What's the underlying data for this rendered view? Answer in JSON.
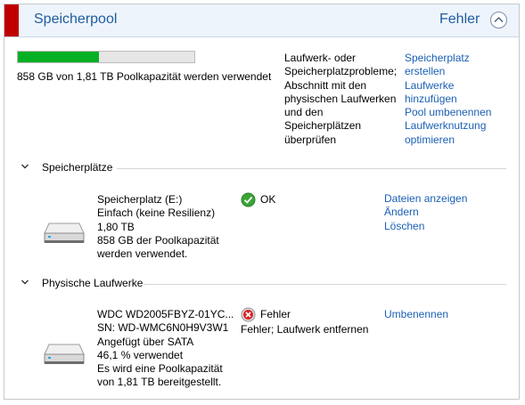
{
  "header": {
    "title": "Speicherpool",
    "status": "Fehler",
    "flag_color": "#c00000",
    "collapse_icon": "chevron-up-icon"
  },
  "pool": {
    "usage_fraction": 0.46,
    "usage_text": "858 GB von 1,81 TB Poolkapazität werden verwendet",
    "problem_text": "Laufwerk- oder Speicherplatzprobleme; Abschnitt mit den physischen Laufwerken und den Speicherplätzen überprüfen",
    "actions": [
      "Speicherplatz",
      "erstellen",
      "Laufwerke",
      "hinzufügen",
      "Pool umbenennen",
      "Laufwerknutzung",
      "optimieren"
    ]
  },
  "storage_spaces": {
    "section_label": "Speicherplätze",
    "item": {
      "lines": [
        "Speicherplatz (E:)",
        "Einfach (keine Resilienz)",
        "1,80 TB",
        "858 GB der Poolkapazität",
        "werden verwendet."
      ],
      "status": "OK",
      "status_icon": "ok-check-icon",
      "actions": [
        "Dateien anzeigen",
        "Ändern",
        "Löschen"
      ]
    }
  },
  "physical_drives": {
    "section_label": "Physische Laufwerke",
    "item": {
      "lines": [
        "WDC WD2005FBYZ-01YC...",
        "SN: WD-WMC6N0H9V3W1",
        "Angefügt über SATA",
        "46,1 % verwendet",
        "Es wird eine Poolkapazität",
        "von 1,81 TB bereitgestellt."
      ],
      "status": "Fehler",
      "status_icon": "error-x-icon",
      "status_detail": "Fehler; Laufwerk entfernen",
      "actions": [
        "Umbenennen"
      ]
    }
  },
  "colors": {
    "link": "#1a5fb4",
    "header_text": "#1e5c9e",
    "progress_fill": "#06b025"
  }
}
